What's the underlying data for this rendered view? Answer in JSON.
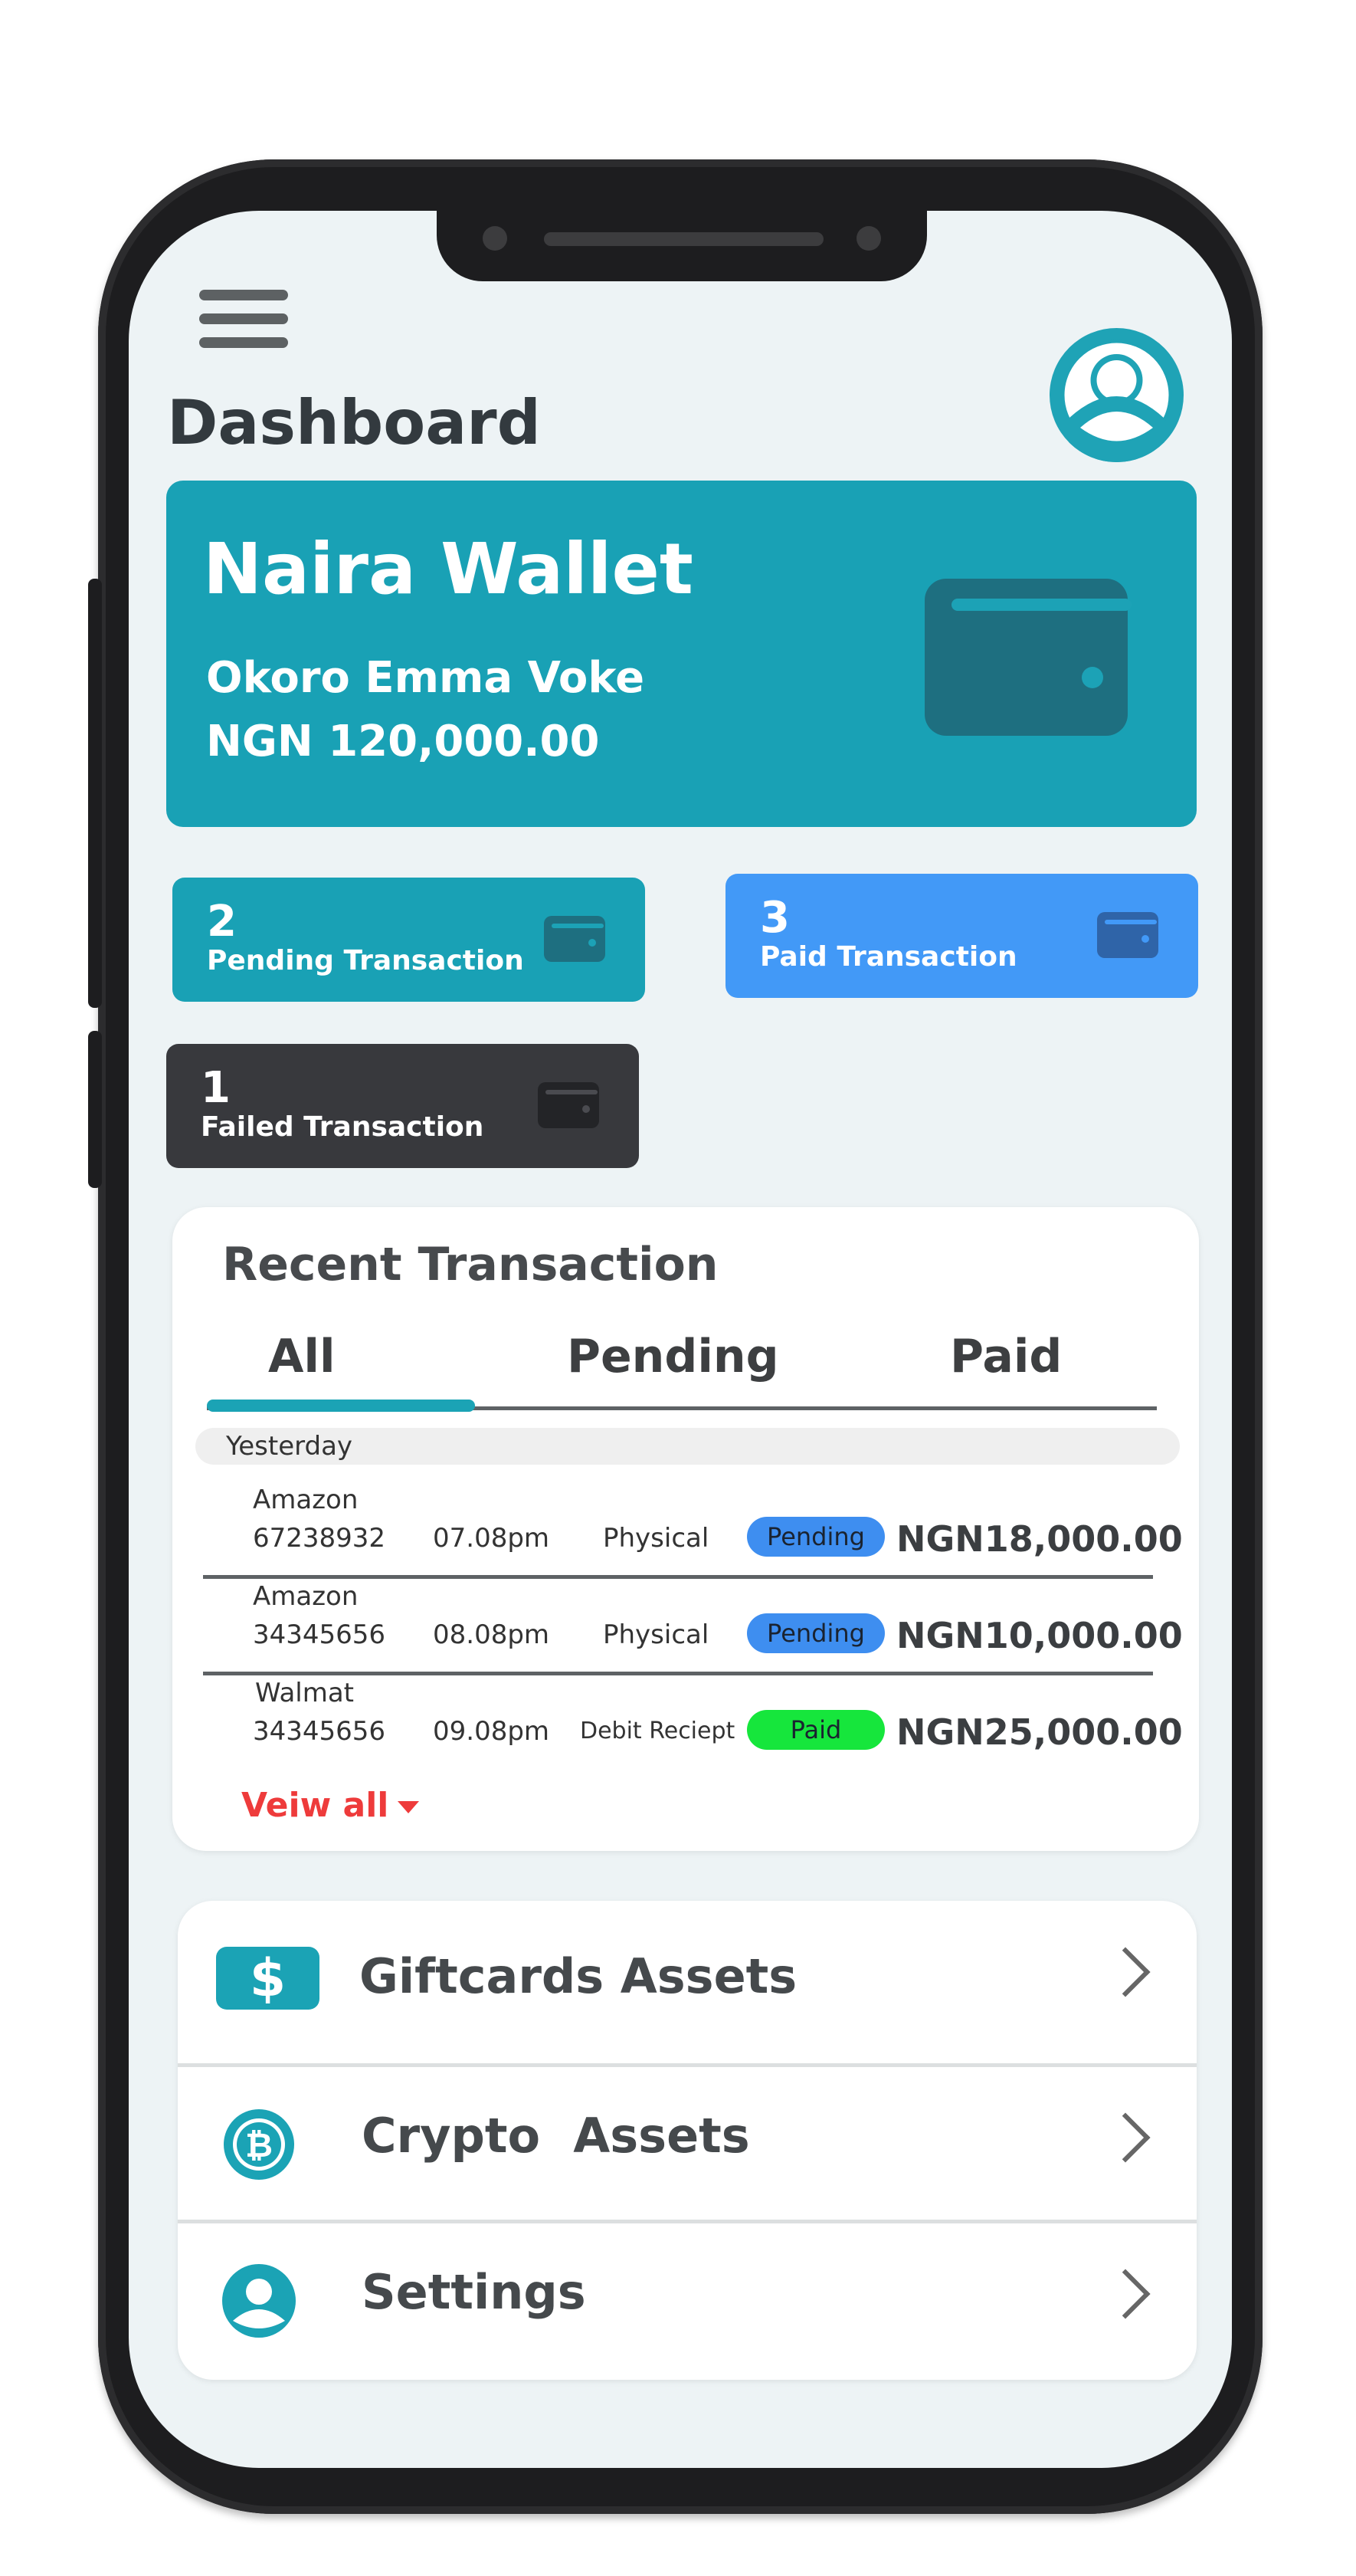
{
  "header": {
    "title": "Dashboard",
    "menu_icon": "hamburger-menu-icon",
    "avatar_icon": "user-avatar-icon"
  },
  "wallet": {
    "name": "Naira Wallet",
    "owner": "Okoro Emma Voke",
    "balance": "NGN 120,000.00",
    "icon": "wallet-icon"
  },
  "stats": {
    "pending": {
      "count": "2",
      "label": "Pending Transaction",
      "color": "#19a1b5"
    },
    "paid": {
      "count": "3",
      "label": "Paid Transaction",
      "color": "#4299f7"
    },
    "failed": {
      "count": "1",
      "label": "Failed Transaction",
      "color": "#38393d"
    }
  },
  "recent": {
    "title": "Recent Transaction",
    "tabs": [
      "All",
      "Pending",
      "Paid"
    ],
    "active_tab": "All",
    "group_label": "Yesterday",
    "rows": [
      {
        "merchant": "Amazon",
        "ref": "67238932",
        "time": "07.08pm",
        "type": "Physical",
        "status": "Pending",
        "amount": "NGN18,000.00"
      },
      {
        "merchant": "Amazon",
        "ref": "34345656",
        "time": "08.08pm",
        "type": "Physical",
        "status": "Pending",
        "amount": "NGN10,000.00"
      },
      {
        "merchant": "Walmat",
        "ref": "34345656",
        "time": "09.08pm",
        "type": "Debit Reciept",
        "status": "Paid",
        "amount": "NGN25,000.00"
      }
    ],
    "view_all": "Veiw all",
    "status_colors": {
      "Pending": "#3e8ef0",
      "Paid": "#16e63c"
    }
  },
  "menu": {
    "items": [
      {
        "label": "Giftcards Assets",
        "icon": "dollar-card-icon"
      },
      {
        "label": "Crypto  Assets",
        "icon": "bitcoin-icon"
      },
      {
        "label": "Settings",
        "icon": "user-settings-icon"
      }
    ]
  }
}
